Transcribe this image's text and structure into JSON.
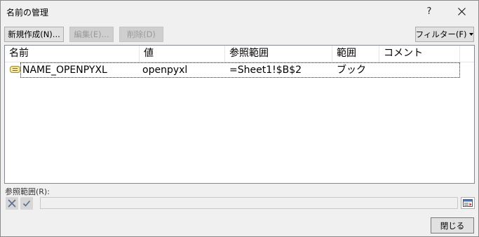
{
  "window": {
    "title": "名前の管理",
    "help_label": "?"
  },
  "toolbar": {
    "new_label": "新規作成(N)...",
    "edit_label": "編集(E)...",
    "delete_label": "削除(D)",
    "filter_label": "フィルター(F)"
  },
  "list": {
    "columns": [
      "名前",
      "値",
      "参照範囲",
      "範囲",
      "コメント"
    ],
    "rows": [
      {
        "name": "NAME_OPENPYXL",
        "value": "openpyxl",
        "refers_to": "=Sheet1!$B$2",
        "scope": "ブック",
        "comment": ""
      }
    ]
  },
  "reference": {
    "label": "参照範囲(R):",
    "value": ""
  },
  "footer": {
    "close_label": "閉じる"
  }
}
